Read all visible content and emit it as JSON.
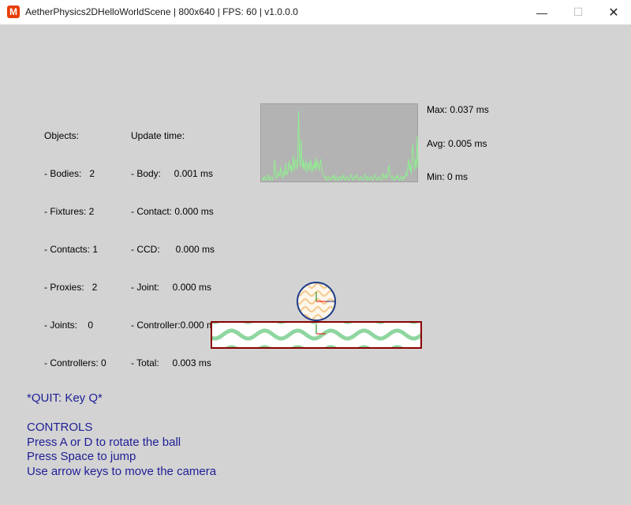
{
  "window": {
    "icon_glyph": "M",
    "title": "AetherPhysics2DHelloWorldScene | 800x640 | FPS: 60 | v1.0.0.0",
    "minimize_glyph": "—",
    "maximize_glyph": "☐",
    "close_glyph": "✕"
  },
  "stats": {
    "objects": {
      "header": "Objects:",
      "lines": [
        "- Bodies:   2",
        "- Fixtures: 2",
        "- Contacts: 1",
        "- Proxies:   2",
        "- Joints:    0",
        "- Controllers: 0"
      ]
    },
    "update_time": {
      "header": "Update time:",
      "lines": [
        "- Body:     0.001 ms",
        "- Contact: 0.000 ms",
        "- CCD:      0.000 ms",
        "- Joint:     0.000 ms",
        "- Controller:0.000 ms",
        "- Total:     0.003 ms"
      ]
    }
  },
  "graph": {
    "max_label": "Max: 0.037 ms",
    "avg_label": "Avg: 0.005 ms",
    "min_label": "Min: 0 ms",
    "line_color": "#90ee90",
    "background": "#b3b3b3",
    "samples_ms": [
      0.001,
      0.002,
      0.001,
      0.003,
      0.002,
      0.001,
      0.002,
      0.004,
      0.002,
      0.001,
      0.003,
      0.002,
      0.001,
      0.002,
      0.003,
      0.012,
      0.005,
      0.002,
      0.003,
      0.006,
      0.004,
      0.003,
      0.008,
      0.005,
      0.002,
      0.004,
      0.006,
      0.003,
      0.01,
      0.005,
      0.004,
      0.007,
      0.011,
      0.006,
      0.009,
      0.005,
      0.008,
      0.014,
      0.006,
      0.01,
      0.012,
      0.007,
      0.009,
      0.037,
      0.015,
      0.008,
      0.022,
      0.01,
      0.007,
      0.012,
      0.006,
      0.009,
      0.011,
      0.005,
      0.008,
      0.01,
      0.006,
      0.012,
      0.008,
      0.005,
      0.009,
      0.007,
      0.011,
      0.006,
      0.013,
      0.008,
      0.01,
      0.006,
      0.009,
      0.012,
      0.007,
      0.005,
      0.004,
      0.003,
      0.002,
      0.003,
      0.001,
      0.002,
      0.003,
      0.002,
      0.001,
      0.002,
      0.003,
      0.002,
      0.004,
      0.002,
      0.001,
      0.003,
      0.002,
      0.001,
      0.002,
      0.003,
      0.002,
      0.001,
      0.003,
      0.002,
      0.004,
      0.002,
      0.001,
      0.002,
      0.003,
      0.002,
      0.001,
      0.002,
      0.003,
      0.004,
      0.002,
      0.001,
      0.002,
      0.003,
      0.002,
      0.004,
      0.003,
      0.002,
      0.001,
      0.002,
      0.003,
      0.002,
      0.001,
      0.002,
      0.003,
      0.004,
      0.002,
      0.001,
      0.003,
      0.002,
      0.001,
      0.002,
      0.003,
      0.002,
      0.001,
      0.002,
      0.004,
      0.003,
      0.002,
      0.001,
      0.002,
      0.003,
      0.002,
      0.001,
      0.002,
      0.003,
      0.005,
      0.002,
      0.003,
      0.004,
      0.002,
      0.003,
      0.006,
      0.009,
      0.004,
      0.003,
      0.002,
      0.003,
      0.002,
      0.001,
      0.002,
      0.003,
      0.002,
      0.004,
      0.002,
      0.001,
      0.002,
      0.003,
      0.002,
      0.001,
      0.003,
      0.002,
      0.004,
      0.005,
      0.003,
      0.008,
      0.012,
      0.006,
      0.009,
      0.004,
      0.015,
      0.02,
      0.01,
      0.006,
      0.012,
      0.008,
      0.024,
      0.007
    ]
  },
  "scene": {
    "ball_fill": "#fdf6ea",
    "ball_pattern": "#f5c98c",
    "ball_outline": "#1a3a8a",
    "ground_fill": "#ffffff",
    "ground_pattern": "#8fd6a0",
    "ground_outline": "#8b0000",
    "axis_x_color": "#ff0000",
    "axis_y_color": "#008000"
  },
  "help": {
    "quit": "*QUIT: Key Q*",
    "controls": [
      "CONTROLS",
      "Press A or D to rotate the ball",
      "Press Space to jump",
      "Use arrow keys to move the camera"
    ]
  }
}
